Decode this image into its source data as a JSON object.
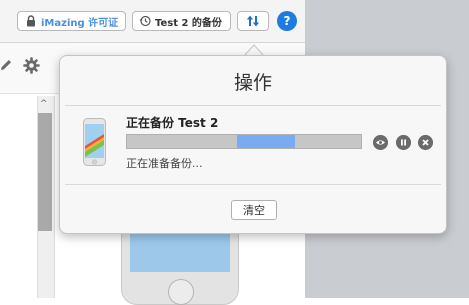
{
  "toolbar": {
    "license_label": "iMazing 许可证",
    "backup_label": "Test 2 的备份",
    "help_label": "?"
  },
  "icons": {
    "lock": "lock-icon",
    "history": "history-icon",
    "transfer": "transfer-arrows-icon",
    "pencil": "pencil-icon",
    "gear": "gear-icon",
    "eye": "eye-icon",
    "pause": "pause-icon",
    "cancel": "cancel-icon"
  },
  "colors": {
    "accent": "#1e7be0",
    "license_text": "#4a90d9",
    "progress_fill": "#79aaf2",
    "progress_track": "#c6c6c6"
  },
  "operations": {
    "title": "操作",
    "task": {
      "name": "正在备份 Test 2",
      "status": "正在准备备份...",
      "progress_start": 0.47,
      "progress_end": 0.72
    },
    "clear_label": "清空"
  }
}
